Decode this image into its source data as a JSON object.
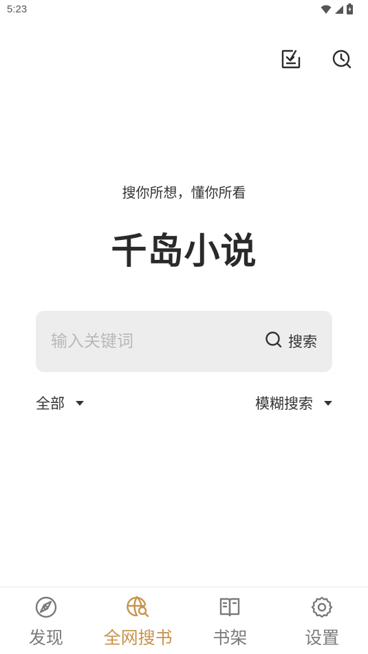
{
  "status_bar": {
    "time": "5:23",
    "icons": [
      "wifi-icon",
      "cell-signal-icon",
      "battery-charging-icon"
    ]
  },
  "top_actions": {
    "icons": [
      "download-icon",
      "history-icon"
    ]
  },
  "hero": {
    "slogan": "搜你所想，懂你所看",
    "title": "千岛小说"
  },
  "search": {
    "placeholder": "输入关键词",
    "value": "",
    "button_label": "搜索",
    "button_icon": "search-icon"
  },
  "filters": {
    "scope": "全部",
    "mode": "模糊搜索"
  },
  "bottom_nav": {
    "items": [
      {
        "label": "发现",
        "icon": "compass-icon",
        "active": false
      },
      {
        "label": "全网搜书",
        "icon": "globe-search-icon",
        "active": true
      },
      {
        "label": "书架",
        "icon": "book-icon",
        "active": false
      },
      {
        "label": "设置",
        "icon": "gear-icon",
        "active": false
      }
    ]
  },
  "colors": {
    "accent": "#c8924c",
    "inactive": "#7a7a7a",
    "search_bg": "#ededed"
  }
}
